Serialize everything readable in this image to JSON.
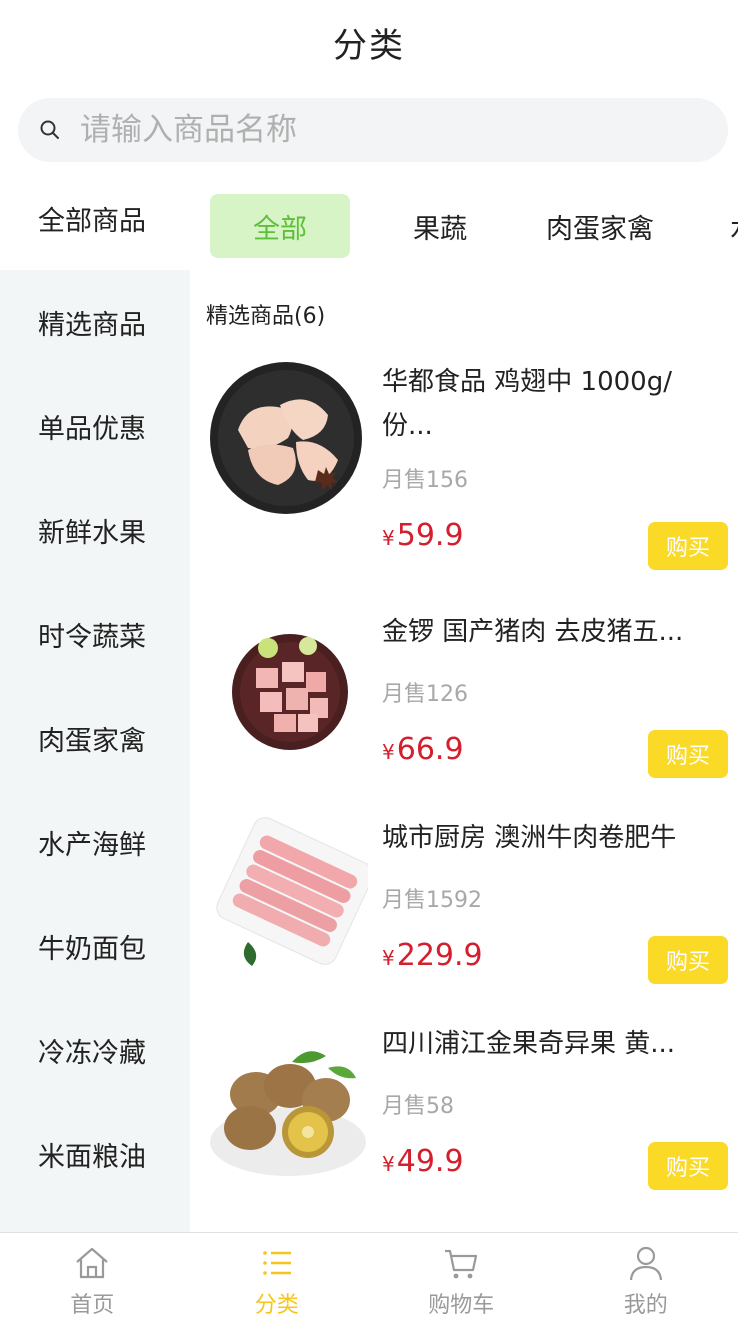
{
  "header": {
    "title": "分类"
  },
  "search": {
    "placeholder": "请输入商品名称",
    "icon": "search-icon"
  },
  "sidebar": {
    "items": [
      {
        "label": "全部商品",
        "active": true
      },
      {
        "label": "精选商品"
      },
      {
        "label": "单品优惠"
      },
      {
        "label": "新鲜水果"
      },
      {
        "label": "时令蔬菜"
      },
      {
        "label": "肉蛋家禽"
      },
      {
        "label": "水产海鲜"
      },
      {
        "label": "牛奶面包"
      },
      {
        "label": "冷冻冷藏"
      },
      {
        "label": "米面粮油"
      }
    ]
  },
  "tabs": [
    {
      "label": "全部",
      "active": true
    },
    {
      "label": "果蔬"
    },
    {
      "label": "肉蛋家禽"
    },
    {
      "label": "水"
    }
  ],
  "section": {
    "title": "精选商品(6)"
  },
  "products": [
    {
      "name": "华都食品 鸡翅中 1000g/份...",
      "sales": "月售156",
      "currency": "¥",
      "price": "59.9",
      "buy": "购买",
      "image": "chicken-wings-image"
    },
    {
      "name": "金锣 国产猪肉 去皮猪五...",
      "sales": "月售126",
      "currency": "¥",
      "price": "66.9",
      "buy": "购买",
      "image": "pork-belly-image"
    },
    {
      "name": "城市厨房 澳洲牛肉卷肥牛",
      "sales": "月售1592",
      "currency": "¥",
      "price": "229.9",
      "buy": "购买",
      "image": "beef-rolls-image"
    },
    {
      "name": "四川浦江金果奇异果 黄...",
      "sales": "月售58",
      "currency": "¥",
      "price": "49.9",
      "buy": "购买",
      "image": "kiwi-image"
    }
  ],
  "tabbar": [
    {
      "label": "首页",
      "icon": "home-icon"
    },
    {
      "label": "分类",
      "icon": "list-icon",
      "active": true
    },
    {
      "label": "购物车",
      "icon": "cart-icon"
    },
    {
      "label": "我的",
      "icon": "user-icon"
    }
  ],
  "colors": {
    "accent": "#f5c51e",
    "price": "#d4202e",
    "tab_active_bg": "#d6f4c6",
    "tab_active_text": "#5fbf3a",
    "buy_button": "#fbd927"
  }
}
